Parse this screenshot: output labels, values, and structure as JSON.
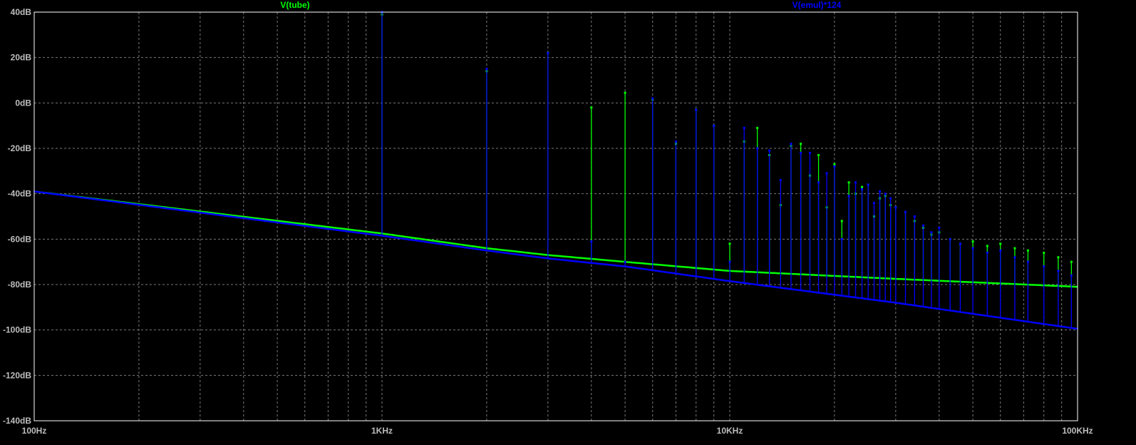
{
  "chart_data": {
    "type": "line",
    "x_scale": "log",
    "xlim": [
      100,
      100000
    ],
    "ylim": [
      -140,
      40
    ],
    "grid": true,
    "background": "#000000",
    "grid_color": "#7a7a7a",
    "axis_color": "#ffffff",
    "text_color": "#bdbdbd",
    "y_ticks": [
      {
        "value": 40,
        "label": "40dB"
      },
      {
        "value": 20,
        "label": "20dB"
      },
      {
        "value": 0,
        "label": "0dB"
      },
      {
        "value": -20,
        "label": "-20dB"
      },
      {
        "value": -40,
        "label": "-40dB"
      },
      {
        "value": -60,
        "label": "-60dB"
      },
      {
        "value": -80,
        "label": "-80dB"
      },
      {
        "value": -100,
        "label": "-100dB"
      },
      {
        "value": -120,
        "label": "-120dB"
      },
      {
        "value": -140,
        "label": "-140dB"
      }
    ],
    "x_ticks": [
      {
        "value": 100,
        "label": "100Hz"
      },
      {
        "value": 1000,
        "label": "1KHz"
      },
      {
        "value": 10000,
        "label": "10KHz"
      },
      {
        "value": 100000,
        "label": "100KHz"
      }
    ],
    "series": [
      {
        "name": "V(tube)",
        "color": "#00ff00",
        "floor": [
          [
            100,
            -39
          ],
          [
            1000,
            -57.5
          ],
          [
            2000,
            -64
          ],
          [
            3000,
            -67
          ],
          [
            5000,
            -70
          ],
          [
            10000,
            -74
          ],
          [
            30000,
            -77.5
          ],
          [
            100000,
            -81
          ]
        ],
        "peaks": [
          [
            1000,
            39
          ],
          [
            2000,
            14
          ],
          [
            3000,
            22
          ],
          [
            4000,
            -2
          ],
          [
            5000,
            4.5
          ],
          [
            6000,
            1.5
          ],
          [
            7000,
            -18
          ],
          [
            8000,
            -3
          ],
          [
            9000,
            -10
          ],
          [
            10000,
            -62
          ],
          [
            11000,
            -17
          ],
          [
            12000,
            -11
          ],
          [
            13000,
            -23
          ],
          [
            14000,
            -45
          ],
          [
            15000,
            -19
          ],
          [
            16000,
            -18
          ],
          [
            17000,
            -32
          ],
          [
            18000,
            -23
          ],
          [
            19000,
            -46
          ],
          [
            20000,
            -27
          ],
          [
            21000,
            -52
          ],
          [
            22000,
            -35
          ],
          [
            23000,
            -40
          ],
          [
            24000,
            -37
          ],
          [
            25000,
            -36
          ],
          [
            26000,
            -50
          ],
          [
            27000,
            -42
          ],
          [
            28000,
            -41
          ],
          [
            29000,
            -45
          ],
          [
            30000,
            -46
          ],
          [
            32000,
            -48
          ],
          [
            34000,
            -52
          ],
          [
            36000,
            -55
          ],
          [
            38000,
            -58
          ],
          [
            40000,
            -57
          ],
          [
            43000,
            -60
          ],
          [
            46000,
            -62
          ],
          [
            50000,
            -61
          ],
          [
            55000,
            -63
          ],
          [
            60000,
            -62
          ],
          [
            66000,
            -64
          ],
          [
            72000,
            -65
          ],
          [
            80000,
            -66
          ],
          [
            88000,
            -68
          ],
          [
            96000,
            -70
          ]
        ]
      },
      {
        "name": "V(emul)*124",
        "color": "#0000ff",
        "floor": [
          [
            100,
            -39
          ],
          [
            1000,
            -58.5
          ],
          [
            2000,
            -65
          ],
          [
            3000,
            -68.5
          ],
          [
            5000,
            -72
          ],
          [
            10000,
            -78.5
          ],
          [
            30000,
            -88
          ],
          [
            100000,
            -99.5
          ]
        ],
        "peaks": [
          [
            1000,
            40
          ],
          [
            2000,
            15
          ],
          [
            3000,
            22
          ],
          [
            4000,
            -61
          ],
          [
            5000,
            -70
          ],
          [
            6000,
            2
          ],
          [
            7000,
            -17
          ],
          [
            8000,
            -3
          ],
          [
            9000,
            -10
          ],
          [
            10000,
            -70
          ],
          [
            11000,
            -11
          ],
          [
            12000,
            -20
          ],
          [
            13000,
            -21
          ],
          [
            14000,
            -34
          ],
          [
            15000,
            -18
          ],
          [
            16000,
            -22
          ],
          [
            17000,
            -22
          ],
          [
            18000,
            -35
          ],
          [
            19000,
            -31
          ],
          [
            20000,
            -28
          ],
          [
            21000,
            -60
          ],
          [
            22000,
            -41
          ],
          [
            23000,
            -35
          ],
          [
            24000,
            -38
          ],
          [
            25000,
            -36
          ],
          [
            26000,
            -44
          ],
          [
            27000,
            -39
          ],
          [
            28000,
            -40
          ],
          [
            29000,
            -42
          ],
          [
            30000,
            -46
          ],
          [
            32000,
            -48
          ],
          [
            34000,
            -50
          ],
          [
            36000,
            -54
          ],
          [
            38000,
            -57
          ],
          [
            40000,
            -55
          ],
          [
            43000,
            -60
          ],
          [
            46000,
            -62
          ],
          [
            50000,
            -64
          ],
          [
            55000,
            -66
          ],
          [
            60000,
            -65
          ],
          [
            66000,
            -68
          ],
          [
            72000,
            -70
          ],
          [
            80000,
            -72
          ],
          [
            88000,
            -74
          ],
          [
            96000,
            -76
          ]
        ]
      }
    ]
  }
}
